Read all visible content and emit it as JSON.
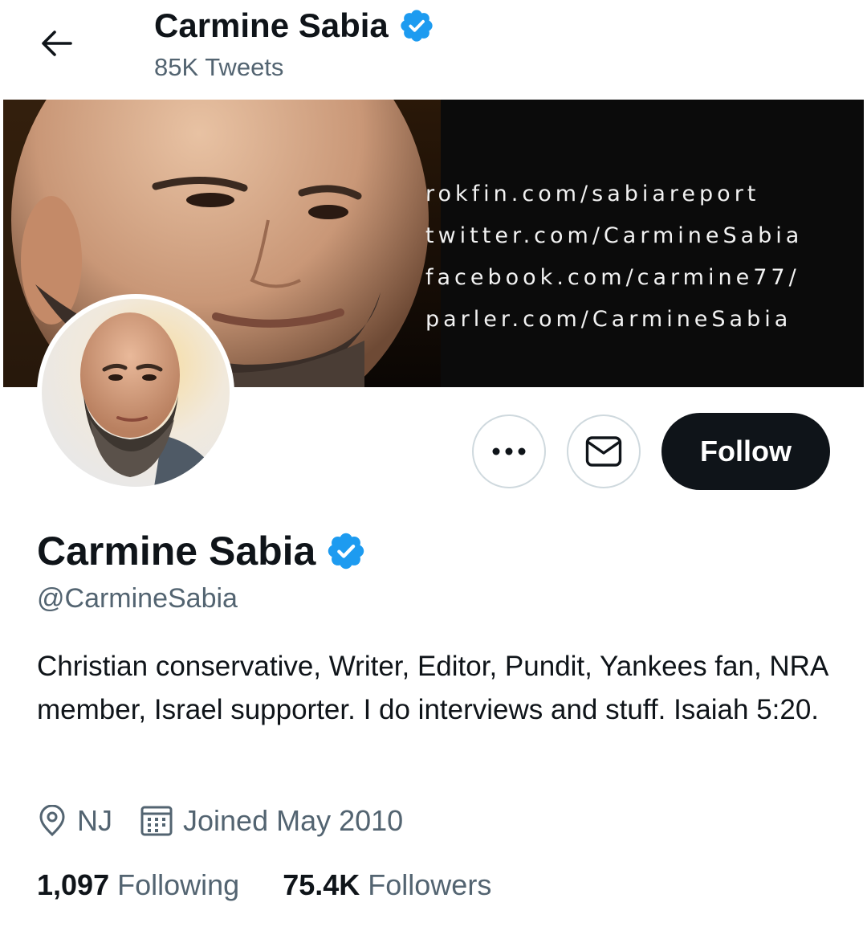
{
  "header": {
    "name": "Carmine Sabia",
    "tweet_count": "85K Tweets"
  },
  "banner": {
    "links": [
      "rokfin.com/sabiareport",
      "twitter.com/CarmineSabia",
      "facebook.com/carmine77/",
      "parler.com/CarmineSabia"
    ]
  },
  "actions": {
    "more_icon": "more-icon",
    "message_icon": "envelope-icon",
    "follow_label": "Follow"
  },
  "profile": {
    "name": "Carmine Sabia",
    "handle": "@CarmineSabia",
    "bio": "Christian conservative, Writer, Editor, Pundit, Yankees fan, NRA member, Israel supporter. I do interviews and stuff. Isaiah 5:20.",
    "location": "NJ",
    "joined": "Joined May 2010",
    "following_count": "1,097",
    "following_label": "Following",
    "followers_count": "75.4K",
    "followers_label": "Followers"
  },
  "colors": {
    "verified_blue": "#1d9bf0",
    "text_primary": "#0f1419",
    "text_secondary": "#536471",
    "follow_bg": "#0f1419"
  }
}
